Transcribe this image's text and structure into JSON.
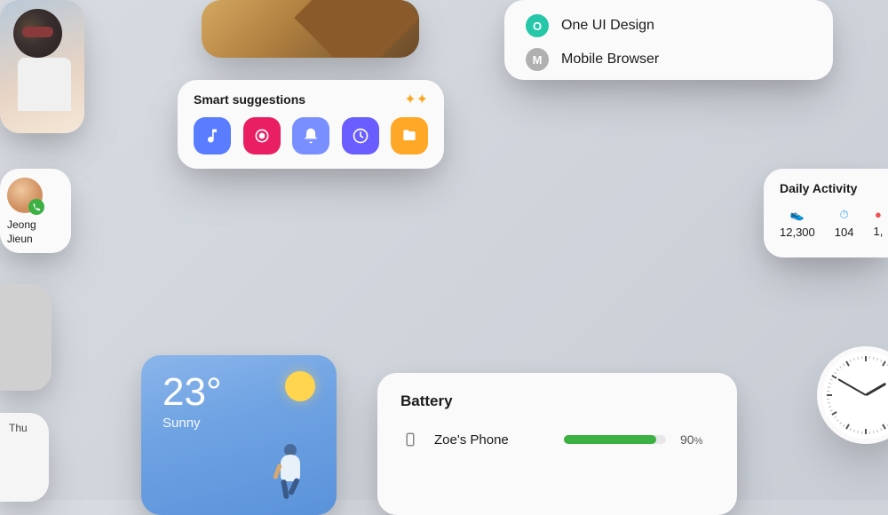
{
  "browserList": {
    "item1": {
      "letter": "O",
      "label": "One UI Design",
      "color": "#26c6a8"
    },
    "item2": {
      "letter": "M",
      "label": "Mobile Browser",
      "color": "#b0b0b0"
    }
  },
  "suggestions": {
    "title": "Smart suggestions",
    "apps": [
      {
        "name": "music",
        "bg": "#5a7dff"
      },
      {
        "name": "camera",
        "bg": "#e91e63"
      },
      {
        "name": "notifications",
        "bg": "#7a8fff"
      },
      {
        "name": "clock",
        "bg": "#6a5dff"
      },
      {
        "name": "files",
        "bg": "#ffa726"
      }
    ]
  },
  "contact": {
    "name_line1": "Jeong",
    "name_line2": "Jieun"
  },
  "activity": {
    "title": "Daily Activity",
    "steps": "12,300",
    "minutes": "104",
    "extra": "1,"
  },
  "weather": {
    "temp": "23°",
    "condition": "Sunny"
  },
  "weatherSmall": {
    "day": "Thu"
  },
  "battery": {
    "title": "Battery",
    "device": "Zoe's Phone",
    "pct": "90",
    "pctLabel": "90%"
  }
}
